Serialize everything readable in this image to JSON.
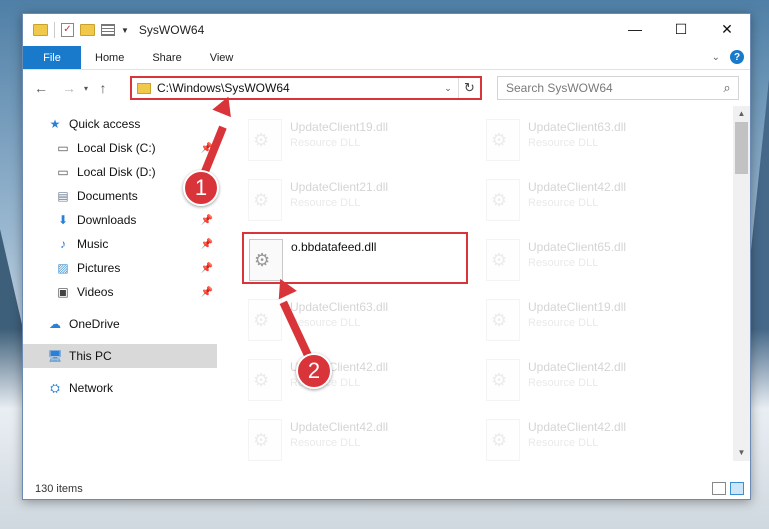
{
  "window": {
    "title": "SysWOW64",
    "controls": {
      "minimize": "—",
      "maximize": "☐",
      "close": "✕"
    }
  },
  "ribbon": {
    "tabs": [
      "File",
      "Home",
      "Share",
      "View"
    ],
    "help": "?"
  },
  "nav": {
    "back": "←",
    "forward": "→",
    "recent": "▾",
    "up": "↑",
    "address": "C:\\Windows\\SysWOW64",
    "search_placeholder": "Search SysWOW64"
  },
  "sidebar": {
    "items": [
      {
        "label": "Quick access",
        "icon": "star-icon",
        "pinned": false
      },
      {
        "label": "Local Disk (C:)",
        "icon": "drive-icon",
        "pinned": true
      },
      {
        "label": "Local Disk (D:)",
        "icon": "drive-icon",
        "pinned": false
      },
      {
        "label": "Documents",
        "icon": "documents-icon",
        "pinned": true
      },
      {
        "label": "Downloads",
        "icon": "download-icon",
        "pinned": true
      },
      {
        "label": "Music",
        "icon": "music-icon",
        "pinned": true
      },
      {
        "label": "Pictures",
        "icon": "pictures-icon",
        "pinned": true
      },
      {
        "label": "Videos",
        "icon": "videos-icon",
        "pinned": true
      },
      {
        "label": "OneDrive",
        "icon": "cloud-icon",
        "pinned": false
      },
      {
        "label": "This PC",
        "icon": "computer-icon",
        "pinned": false,
        "selected": true
      },
      {
        "label": "Network",
        "icon": "network-icon",
        "pinned": false
      }
    ]
  },
  "files": {
    "left": [
      {
        "name": "UpdateClient19.dll",
        "type": "Resource DLL"
      },
      {
        "name": "UpdateClient21.dll",
        "type": "Resource DLL"
      },
      {
        "name": "o.bbdatafeed.dll",
        "type": ""
      },
      {
        "name": "UpdateClient63.dll",
        "type": "Resource DLL"
      },
      {
        "name": "UpdateClient42.dll",
        "type": "Resource DLL"
      },
      {
        "name": "UpdateClient42.dll",
        "type": "Resource DLL"
      }
    ],
    "right": [
      {
        "name": "UpdateClient63.dll",
        "type": "Resource DLL"
      },
      {
        "name": "UpdateClient42.dll",
        "type": "Resource DLL"
      },
      {
        "name": "UpdateClient65.dll",
        "type": "Resource DLL"
      },
      {
        "name": "UpdateClient19.dll",
        "type": "Resource DLL"
      },
      {
        "name": "UpdateClient42.dll",
        "type": "Resource DLL"
      },
      {
        "name": "UpdateClient42.dll",
        "type": "Resource DLL"
      }
    ]
  },
  "status": {
    "count": "130 items"
  },
  "annotations": {
    "step1": "1",
    "step2": "2"
  },
  "colors": {
    "accent": "#1979ca",
    "highlight": "#d9343a"
  }
}
